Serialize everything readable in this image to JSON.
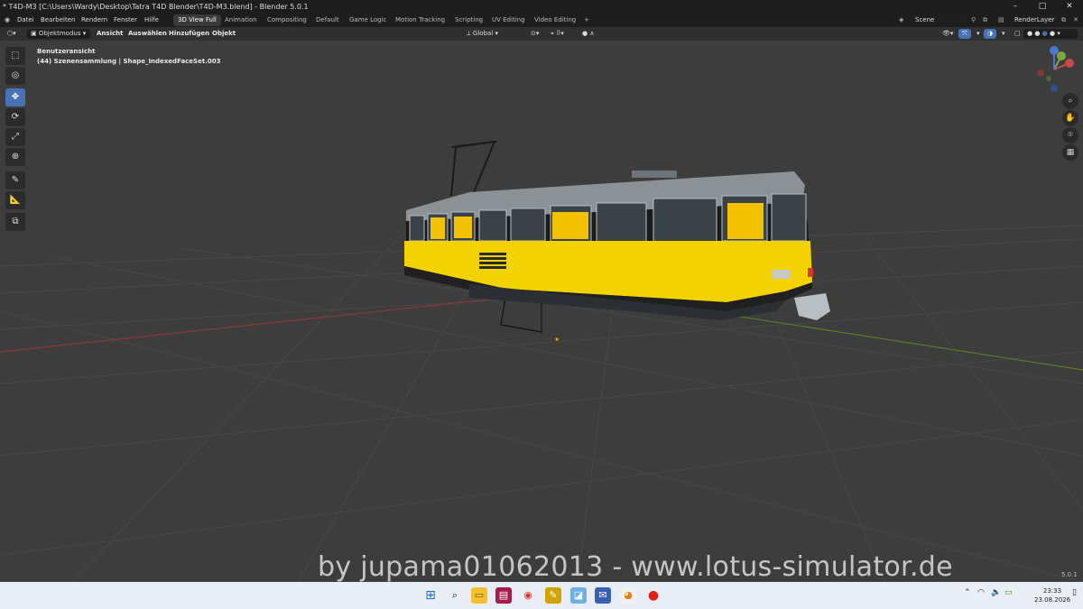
{
  "window": {
    "title": "* T4D-M3 [C:\\Users\\Wardy\\Desktop\\Tatra T4D Blender\\T4D-M3.blend] - Blender 5.0.1",
    "controls": {
      "minimize": "–",
      "maximize": "□",
      "close": "✕"
    }
  },
  "menu": {
    "items": [
      "Datei",
      "Bearbeiten",
      "Rendern",
      "Fenster",
      "Hilfe"
    ]
  },
  "workspaces": {
    "tabs": [
      "3D View Full",
      "Animation",
      "Compositing",
      "Default",
      "Game Logic",
      "Motion Tracking",
      "Scripting",
      "UV Editing",
      "Video Editing"
    ],
    "add": "+",
    "active": "3D View Full"
  },
  "scene": {
    "label": "Scene",
    "render_layer": "RenderLayer"
  },
  "header": {
    "mode": "Objektmodus",
    "menus": [
      "Ansicht",
      "Auswählen",
      "Hinzufügen",
      "Objekt"
    ],
    "transform_orientation": "Global"
  },
  "viewport": {
    "view_name": "Benutzeransicht",
    "collection_info": "(44) Szenensammlung | Shape_IndexedFaceSet.003",
    "background": "#3d3d3d",
    "tram_color": "#f2d200",
    "roof_color": "#8c9196"
  },
  "tools": [
    {
      "name": "select-box-tool",
      "glyph": "⬚"
    },
    {
      "name": "cursor-tool",
      "glyph": "◎"
    },
    {
      "name": "move-tool",
      "glyph": "✥"
    },
    {
      "name": "rotate-tool",
      "glyph": "⟳"
    },
    {
      "name": "scale-tool",
      "glyph": "⤢"
    },
    {
      "name": "transform-tool",
      "glyph": "⊕"
    },
    {
      "name": "annotate-tool",
      "glyph": "✎"
    },
    {
      "name": "measure-tool",
      "glyph": "📐"
    },
    {
      "name": "add-cube-tool",
      "glyph": "⧉"
    }
  ],
  "gizmo": {
    "x": "X",
    "y": "Y",
    "z": "Z"
  },
  "watermark": "by jupama01062013 - www.lotus-simulator.de",
  "version": "5.0.1",
  "taskbar": {
    "time": "23:33",
    "date": "23.08.2026"
  }
}
